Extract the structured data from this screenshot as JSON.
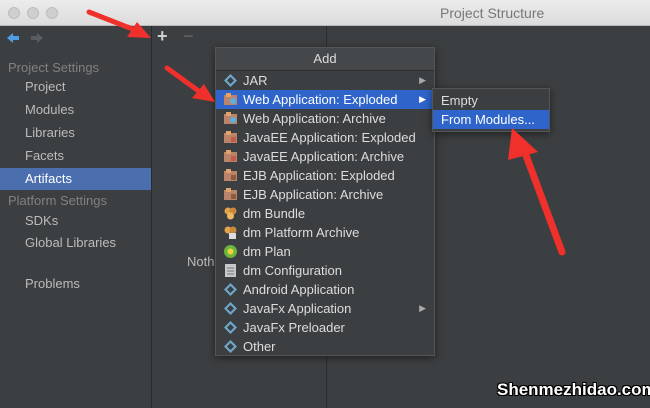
{
  "window": {
    "title": "Project Structure"
  },
  "sidebar": {
    "project_settings_label": "Project Settings",
    "project_items": [
      {
        "label": "Project"
      },
      {
        "label": "Modules"
      },
      {
        "label": "Libraries"
      },
      {
        "label": "Facets"
      },
      {
        "label": "Artifacts"
      }
    ],
    "platform_settings_label": "Platform Settings",
    "platform_items": [
      {
        "label": "SDKs"
      },
      {
        "label": "Global Libraries"
      }
    ],
    "problems_label": "Problems",
    "selected_item": "Artifacts"
  },
  "toolbar": {
    "add_label": "+",
    "remove_label": "−"
  },
  "content": {
    "empty_text": "Noth"
  },
  "add_menu": {
    "title": "Add",
    "items": [
      {
        "label": "JAR",
        "icon": "jar-icon",
        "has_submenu": true
      },
      {
        "label": "Web Application: Exploded",
        "icon": "web-app-icon",
        "has_submenu": true,
        "selected": true
      },
      {
        "label": "Web Application: Archive",
        "icon": "web-app-icon"
      },
      {
        "label": "JavaEE Application: Exploded",
        "icon": "javaee-icon"
      },
      {
        "label": "JavaEE Application: Archive",
        "icon": "javaee-icon"
      },
      {
        "label": "EJB Application: Exploded",
        "icon": "ejb-icon"
      },
      {
        "label": "EJB Application: Archive",
        "icon": "ejb-icon"
      },
      {
        "label": "dm Bundle",
        "icon": "dm-bundle-icon"
      },
      {
        "label": "dm Platform Archive",
        "icon": "dm-archive-icon"
      },
      {
        "label": "dm Plan",
        "icon": "dm-plan-icon"
      },
      {
        "label": "dm Configuration",
        "icon": "dm-config-icon"
      },
      {
        "label": "Android Application",
        "icon": "android-icon"
      },
      {
        "label": "JavaFx Application",
        "icon": "javafx-icon",
        "has_submenu": true
      },
      {
        "label": "JavaFx Preloader",
        "icon": "javafx-icon"
      },
      {
        "label": "Other",
        "icon": "other-icon"
      }
    ]
  },
  "submenu": {
    "items": [
      {
        "label": "Empty"
      },
      {
        "label": "From Modules...",
        "selected": true
      }
    ]
  },
  "colors": {
    "selection": "#4b6eaf",
    "menu_selection": "#2f65ca",
    "annotation_arrow": "#f0302a"
  },
  "watermark": "Shenmezhidao.com"
}
